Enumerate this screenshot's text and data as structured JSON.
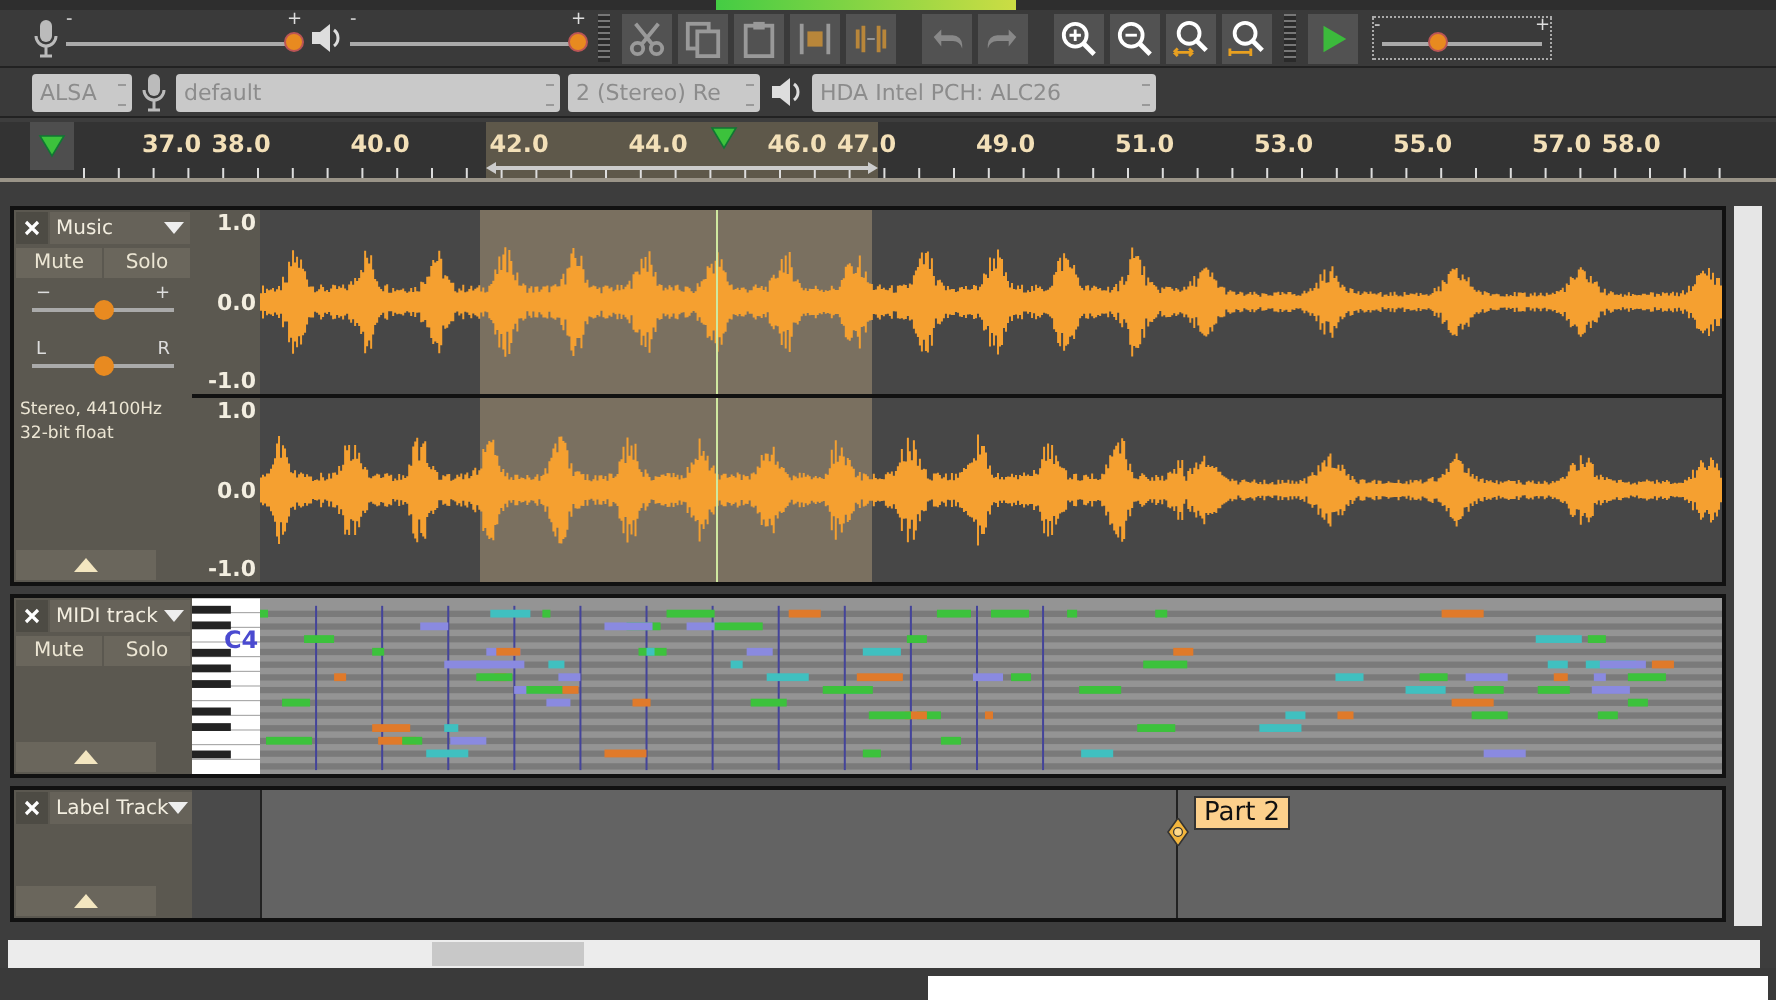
{
  "toolbar": {
    "record_volume": {
      "minus": "-",
      "plus": "+",
      "level": 0.97
    },
    "playback_volume": {
      "minus": "-",
      "plus": "+",
      "level": 0.97
    },
    "play_at_speed": {
      "minus": "-",
      "plus": "+",
      "level": 0.35
    }
  },
  "device_toolbar": {
    "host": "ALSA",
    "recording_device": "default",
    "channels": "2 (Stereo) Re",
    "playback_device": "HDA Intel PCH: ALC26"
  },
  "ruler": {
    "labels": [
      "37.0",
      "38.0",
      "40.0",
      "42.0",
      "44.0",
      "46.0",
      "47.0",
      "49.0",
      "51.0",
      "53.0",
      "55.0",
      "57.0",
      "58.0"
    ]
  },
  "tracks": [
    {
      "kind": "audio",
      "name": "Music",
      "mute": "Mute",
      "solo": "Solo",
      "gain": {
        "minus": "−",
        "plus": "+",
        "level": 0.5
      },
      "pan": {
        "left": "L",
        "right": "R",
        "level": 0.5
      },
      "info": "Stereo, 44100Hz\n32-bit float",
      "channels": [
        {
          "scale": [
            "1.0",
            "0.0",
            "-1.0"
          ]
        },
        {
          "scale": [
            "1.0",
            "0.0",
            "-1.0"
          ]
        }
      ]
    },
    {
      "kind": "midi",
      "name": "MIDI track",
      "mute": "Mute",
      "solo": "Solo",
      "note_label": "C4"
    },
    {
      "kind": "label",
      "name": "Label Track",
      "labels": [
        "Part 2"
      ]
    }
  ]
}
